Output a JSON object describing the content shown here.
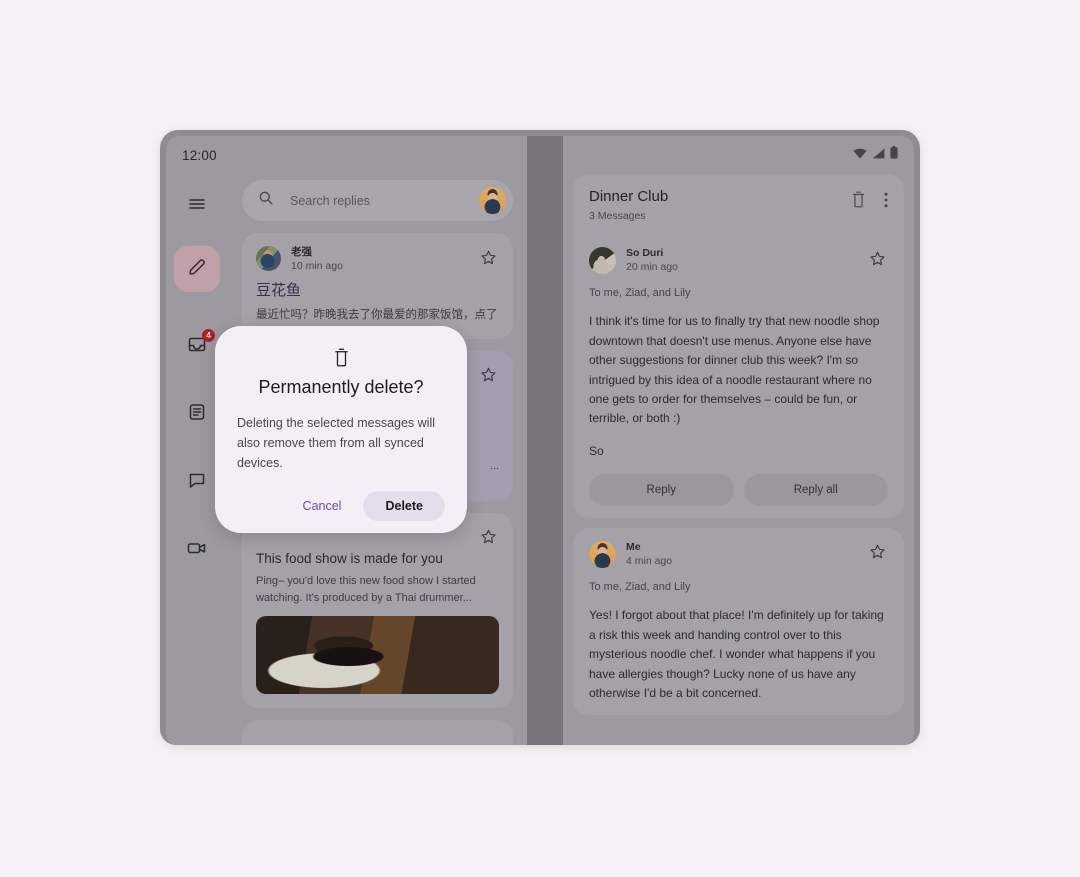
{
  "statusbar": {
    "time": "12:00",
    "icons": [
      "wifi-icon",
      "signal-icon",
      "battery-icon"
    ]
  },
  "nav_rail": {
    "items": [
      {
        "name": "menu",
        "icon": "hamburger-menu-icon",
        "label": "Menu"
      },
      {
        "name": "compose",
        "icon": "pencil-edit-icon",
        "label": "Compose",
        "active": true
      },
      {
        "name": "inbox",
        "icon": "inbox-icon",
        "label": "Inbox",
        "badge": "4"
      },
      {
        "name": "articles",
        "icon": "article-list-icon",
        "label": "Articles"
      },
      {
        "name": "chat",
        "icon": "chat-bubble-icon",
        "label": "Chat"
      },
      {
        "name": "video",
        "icon": "video-camera-icon",
        "label": "Video"
      }
    ]
  },
  "search": {
    "placeholder": "Search replies",
    "icon": "search-icon",
    "avatar": "user-avatar"
  },
  "message_list": {
    "items": [
      {
        "sender": "老强",
        "time": "10 min ago",
        "subject": "豆花鱼",
        "snippet": "最近忙吗？昨晚我去了你最爱的那家饭馆，点了",
        "starred": false
      },
      {
        "sender": "",
        "time": "",
        "subject": "",
        "snippet": "...",
        "starred": false
      },
      {
        "sender": "",
        "time": "",
        "subject": "This food show is made for you",
        "snippet": "Ping– you'd love this new food show I started watching. It's produced by a Thai drummer...",
        "has_media": true,
        "media_alt": "food-show-thumbnail",
        "starred": false
      }
    ]
  },
  "thread": {
    "title": "Dinner Club",
    "subtitle": "3 Messages",
    "actions": [
      {
        "name": "delete",
        "icon": "trash-icon"
      },
      {
        "name": "overflow",
        "icon": "more-vertical-icon"
      }
    ],
    "messages": [
      {
        "sender": "So Duri",
        "time": "20 min ago",
        "recipients": "To me, Ziad, and Lily",
        "body": "I think it's time for us to finally try that new noodle shop downtown that doesn't use menus. Anyone else have other suggestions for dinner club this week? I'm so intrigued by this idea of a noodle restaurant where no one gets to order for themselves – could be fun, or terrible, or both :)",
        "signature": "So",
        "starred": false,
        "avatar": "so-duri-avatar",
        "reply_label": "Reply",
        "reply_all_label": "Reply all"
      },
      {
        "sender": "Me",
        "time": "4 min ago",
        "recipients": "To me, Ziad, and Lily",
        "body": "Yes! I forgot about that place! I'm definitely up for taking a risk this week and handing control over to this mysterious noodle chef. I wonder what happens if you have allergies though? Lucky none of us have any otherwise I'd be a bit concerned.",
        "starred": false,
        "avatar": "me-avatar"
      }
    ]
  },
  "dialog": {
    "icon": "trash-icon",
    "title": "Permanently delete?",
    "body": "Deleting the selected messages will also remove them from all synced devices.",
    "cancel_label": "Cancel",
    "confirm_label": "Delete"
  },
  "colors": {
    "accent": "#6750a4",
    "badge": "#c0202a",
    "dialog_surface": "#f4eff6",
    "confirm_button": "#e5ddec",
    "fab_container": "#e9b3b8",
    "surface": "#b0adb4",
    "background": "#a8a5ab"
  }
}
